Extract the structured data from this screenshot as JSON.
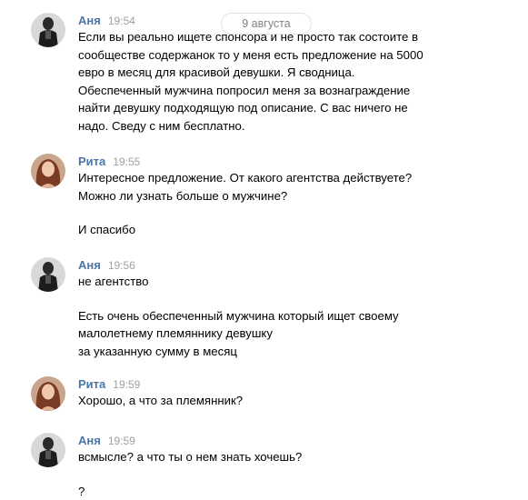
{
  "date_separator": "9 августа",
  "messages": [
    {
      "author": "Аня",
      "time": "19:54",
      "avatar": "person-dark-photo",
      "lines": [
        "Если вы реально ищете спонсора и не просто так состоите в",
        "сообществе содержанок то у меня есть предложение на 5000",
        "евро в месяц для красивой девушки. Я сводница.",
        "Обеспеченный мужчина попросил меня за вознаграждение",
        "найти девушку подходящую под описание. С вас ничего не",
        "надо. Сведу с ним бесплатно."
      ]
    },
    {
      "author": "Рита",
      "time": "19:55",
      "avatar": "woman-photo",
      "lines": [
        "Интересное предложение. От какого агентства действуете?",
        "Можно ли узнать больше о мужчине?"
      ],
      "extra_lines": [
        "И спасибо"
      ]
    },
    {
      "author": "Аня",
      "time": "19:56",
      "avatar": "person-dark-photo",
      "lines": [
        "не агентство"
      ],
      "extra_lines": [
        "Есть очень обеспеченный мужчина который ищет своему",
        "малолетнему племяннику девушку",
        "за указанную сумму в месяц"
      ]
    },
    {
      "author": "Рита",
      "time": "19:59",
      "avatar": "woman-photo",
      "lines": [
        "Хорошо, а что за племянник?"
      ]
    },
    {
      "author": "Аня",
      "time": "19:59",
      "avatar": "person-dark-photo",
      "lines": [
        "всмысле? а что ты о нем знать хочешь?"
      ],
      "extra_lines": [
        "?"
      ]
    }
  ],
  "colors": {
    "author_name": "#4a76a8",
    "timestamp": "#a0a0a0",
    "message_text": "#000000",
    "date_pill_border": "#dfe3e8"
  }
}
